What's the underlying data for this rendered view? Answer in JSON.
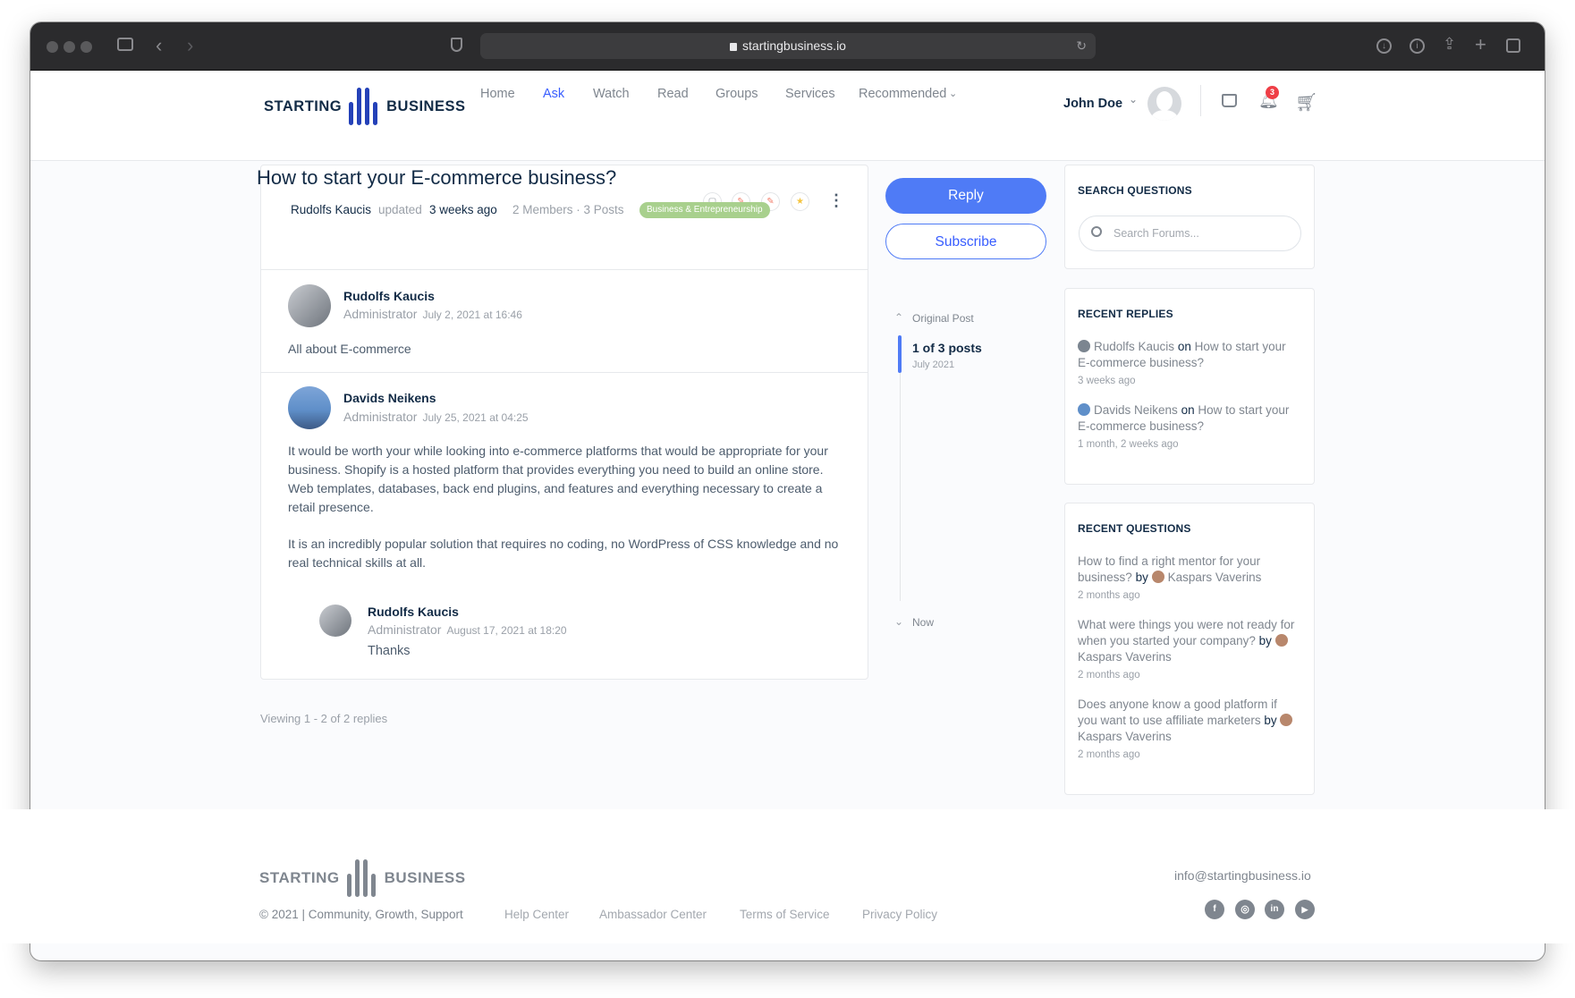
{
  "browser": {
    "url": "startingbusiness.io"
  },
  "header": {
    "logo_left": "STARTING",
    "logo_right": "BUSINESS",
    "nav": [
      "Home",
      "Ask",
      "Watch",
      "Read",
      "Groups",
      "Services",
      "Recommended"
    ],
    "active_nav": "Ask",
    "user_name": "John Doe",
    "notification_count": "3"
  },
  "topic": {
    "title": "How to start your E-commerce business?",
    "author": "Rudolfs Kaucis",
    "updated_word": "updated",
    "updated_ago": "3 weeks ago",
    "stats": "2 Members · 3 Posts",
    "tag": "Business & Entrepreneurship"
  },
  "posts": [
    {
      "name": "Rudolfs Kaucis",
      "role": "Administrator",
      "date": "July 2, 2021 at 16:46",
      "text": "All about E-commerce"
    },
    {
      "name": "Davids Neikens",
      "role": "Administrator",
      "date": "July 25, 2021 at 04:25",
      "text1": "It would be worth your while looking into e-commerce platforms that would be appropriate for your business. Shopify is a hosted platform that provides everything you need to build an online store. Web templates, databases, back end plugins, and features and everything necessary to create a retail presence.",
      "text2": "It is an incredibly popular solution that requires no coding, no WordPress of CSS knowledge and no real technical skills at all."
    },
    {
      "name": "Rudolfs Kaucis",
      "role": "Administrator",
      "date": "August 17, 2021 at 18:20",
      "text": "Thanks"
    }
  ],
  "viewing": "Viewing 1 - 2 of 2 replies",
  "actions": {
    "reply": "Reply",
    "subscribe": "Subscribe"
  },
  "timeline": {
    "original": "Original Post",
    "position": "1 of 3 posts",
    "date": "July 2021",
    "now": "Now"
  },
  "search": {
    "heading": "SEARCH QUESTIONS",
    "placeholder": "Search Forums..."
  },
  "recent_replies": {
    "heading": "RECENT REPLIES",
    "items": [
      {
        "author": "Rudolfs Kaucis",
        "on": "on",
        "topic": "How to start your E-commerce business?",
        "ago": "3 weeks ago"
      },
      {
        "author": "Davids Neikens",
        "on": "on",
        "topic": "How to start your E-commerce business?",
        "ago": "1 month, 2 weeks ago"
      }
    ]
  },
  "recent_questions": {
    "heading": "RECENT QUESTIONS",
    "items": [
      {
        "q": "How to find a right mentor for your business?",
        "by": "by",
        "author": "Kaspars Vaverins",
        "ago": "2 months ago"
      },
      {
        "q": "What were things you were not ready for when you started your company?",
        "by": "by",
        "author": "Kaspars Vaverins",
        "ago": "2 months ago"
      },
      {
        "q": "Does anyone know a good platform if you want to use affiliate marketers",
        "by": "by",
        "author": "Kaspars Vaverins",
        "ago": "2 months ago"
      }
    ]
  },
  "footer": {
    "logo_left": "STARTING",
    "logo_right": "BUSINESS",
    "email": "info@startingbusiness.io",
    "copyright": "© 2021 | Community, Growth, Support",
    "links": [
      "Help Center",
      "Ambassador Center",
      "Terms of Service",
      "Privacy Policy"
    ],
    "social": [
      "f",
      "ig",
      "in",
      "yt"
    ]
  },
  "colors": {
    "accent": "#385dff",
    "tag": "#a8d08d",
    "badge": "#ef3e46",
    "logo_blue": "#2441b8"
  }
}
